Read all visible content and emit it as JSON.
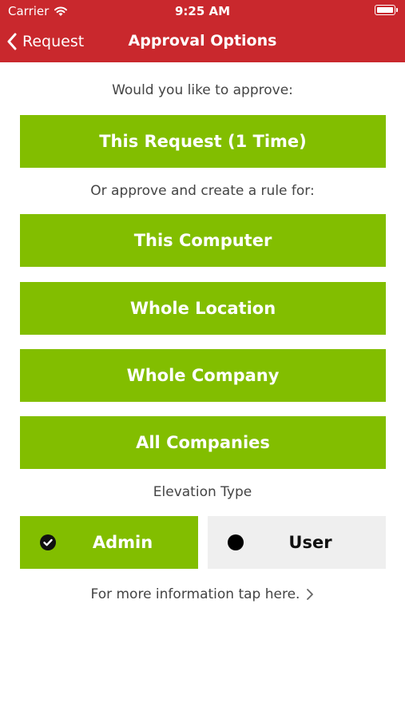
{
  "status_bar": {
    "carrier": "Carrier",
    "time": "9:25 AM"
  },
  "nav": {
    "back_label": "Request",
    "title": "Approval Options"
  },
  "prompt_approve": "Would you like to approve:",
  "btn_this_request": "This Request (1 Time)",
  "prompt_rule": "Or approve and create a rule for:",
  "rule_buttons": [
    "This Computer",
    "Whole Location",
    "Whole Company",
    "All Companies"
  ],
  "elevation": {
    "label": "Elevation Type",
    "options": [
      "Admin",
      "User"
    ],
    "selected": "Admin"
  },
  "more_info": "For more information tap here.",
  "colors": {
    "header": "#c9282d",
    "accent_green": "#82be00",
    "unselected_bg": "#efefef"
  }
}
